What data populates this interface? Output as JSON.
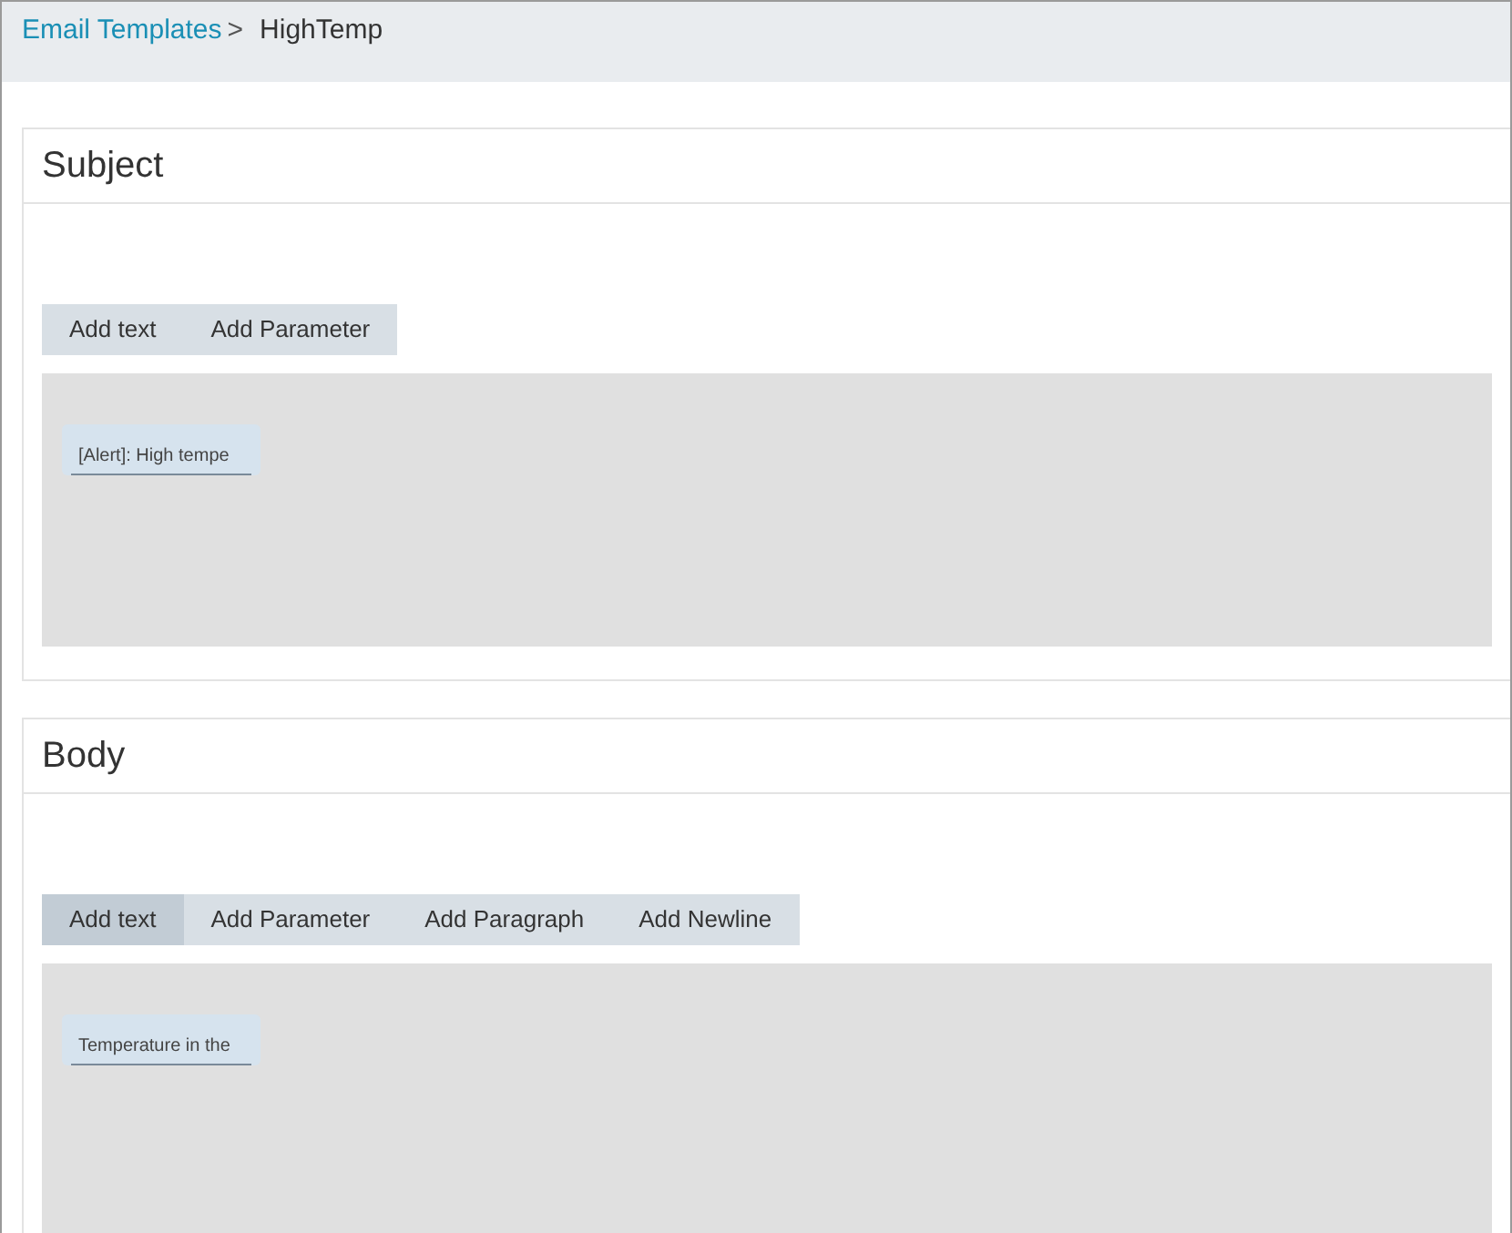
{
  "breadcrumb": {
    "parent": "Email Templates",
    "separator": ">",
    "current": "HighTemp"
  },
  "sections": [
    {
      "title": "Subject",
      "buttons": [
        {
          "label": "Add text",
          "highlighted": false
        },
        {
          "label": "Add Parameter",
          "highlighted": false
        }
      ],
      "fields": [
        {
          "value": "[Alert]: High tempe"
        }
      ]
    },
    {
      "title": "Body",
      "buttons": [
        {
          "label": "Add text",
          "highlighted": true
        },
        {
          "label": "Add Parameter",
          "highlighted": false
        },
        {
          "label": "Add Paragraph",
          "highlighted": false
        },
        {
          "label": "Add Newline",
          "highlighted": false
        }
      ],
      "fields": [
        {
          "value": "Temperature in the"
        }
      ]
    }
  ]
}
